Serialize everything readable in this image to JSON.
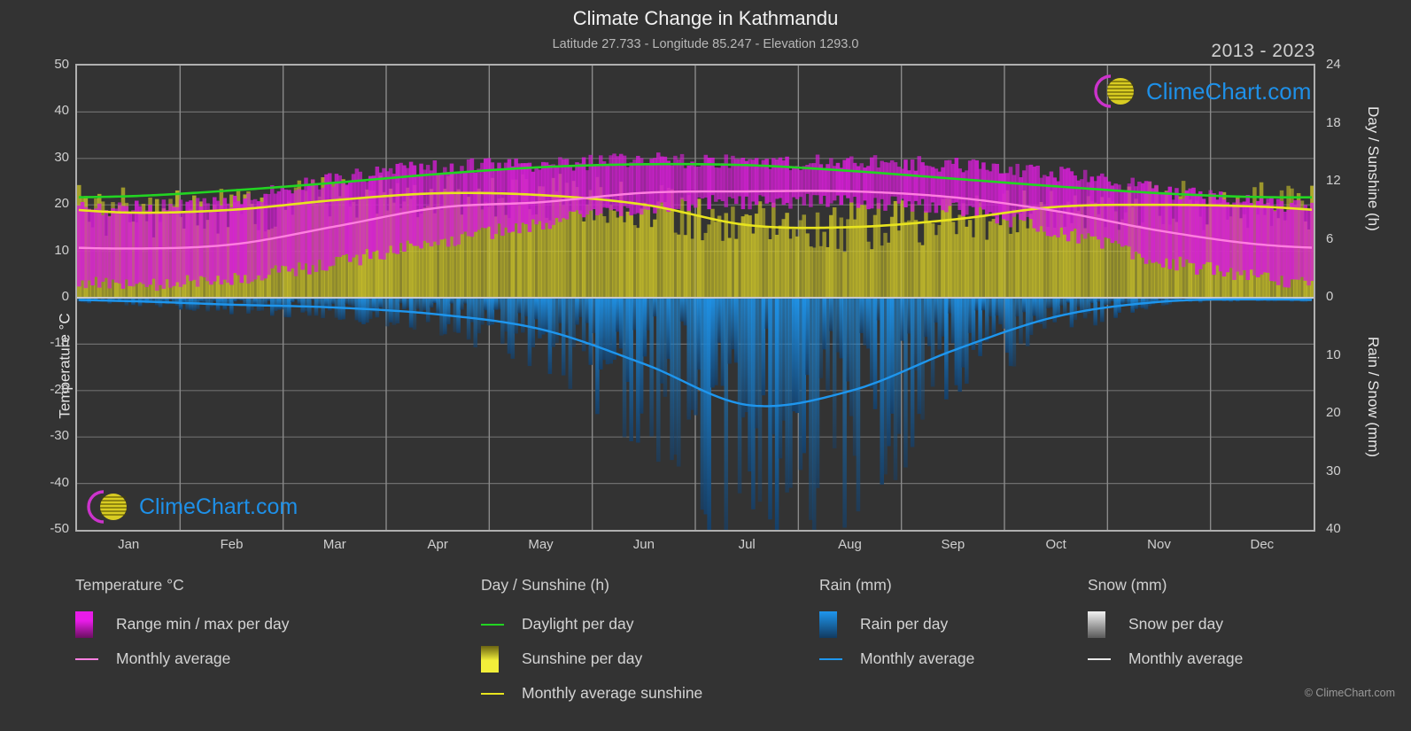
{
  "header": {
    "title": "Climate Change in Kathmandu",
    "subtitle": "Latitude 27.733 - Longitude 85.247 - Elevation 1293.0",
    "years": "2013 - 2023"
  },
  "branding": {
    "watermark_text": "ClimeChart.com",
    "copyright": "© ClimeChart.com",
    "logo_ring_color": "#cc33cc",
    "logo_globe_color": "#d8cc22",
    "logo_text_color": "#1e90e8"
  },
  "axes": {
    "left": {
      "label": "Temperature °C",
      "ticks": [
        "50",
        "40",
        "30",
        "20",
        "10",
        "0",
        "-10",
        "-20",
        "-30",
        "-40",
        "-50"
      ],
      "min": -50,
      "max": 50,
      "step": 10
    },
    "right_top": {
      "label": "Day / Sunshine (h)",
      "ticks": [
        "24",
        "18",
        "12",
        "6",
        "0"
      ],
      "min": 0,
      "max": 24,
      "step": 6
    },
    "right_bottom": {
      "label": "Rain / Snow (mm)",
      "ticks": [
        "0",
        "10",
        "20",
        "30",
        "40"
      ],
      "min": 0,
      "max": 40,
      "step": 10,
      "inverted": true
    },
    "x": {
      "ticks": [
        "Jan",
        "Feb",
        "Mar",
        "Apr",
        "May",
        "Jun",
        "Jul",
        "Aug",
        "Sep",
        "Oct",
        "Nov",
        "Dec"
      ]
    }
  },
  "legend": {
    "groups": [
      {
        "title": "Temperature °C",
        "items": [
          {
            "label": "Range min / max per day",
            "key": "swatch",
            "color": "#e81ce8",
            "color2": "#6a1060"
          },
          {
            "label": "Monthly average",
            "key": "line",
            "color": "#ff7fe0"
          }
        ]
      },
      {
        "title": "Day / Sunshine (h)",
        "items": [
          {
            "label": "Daylight per day",
            "key": "line",
            "color": "#22d422"
          },
          {
            "label": "Sunshine per day",
            "key": "swatch",
            "color": "#f2ef3a",
            "color2": "#6b6412"
          },
          {
            "label": "Monthly average sunshine",
            "key": "line",
            "color": "#e8e41e"
          }
        ]
      },
      {
        "title": "Rain (mm)",
        "items": [
          {
            "label": "Rain per day",
            "key": "swatch",
            "color": "#1e96ee",
            "color2": "#123a60"
          },
          {
            "label": "Monthly average",
            "key": "line",
            "color": "#1e96ee"
          }
        ]
      },
      {
        "title": "Snow (mm)",
        "items": [
          {
            "label": "Snow per day",
            "key": "swatch",
            "color": "#f2f2f2",
            "color2": "#5a5a5a"
          },
          {
            "label": "Monthly average",
            "key": "line",
            "color": "#e8e8e8"
          }
        ]
      }
    ]
  },
  "chart_data": {
    "type": "area",
    "title": "Climate Change in Kathmandu",
    "subtitle": "Latitude 27.733 - Longitude 85.247 - Elevation 1293.0",
    "period": "2013 - 2023",
    "xlabel": "",
    "ylabel": "Temperature °C",
    "ylim": [
      -50,
      50
    ],
    "y2_top_label": "Day / Sunshine (h)",
    "y2_top_lim": [
      0,
      24
    ],
    "y2_bottom_label": "Rain / Snow (mm)",
    "y2_bottom_lim": [
      0,
      40
    ],
    "grid": true,
    "legend_position": "below",
    "categories": [
      "Jan",
      "Feb",
      "Mar",
      "Apr",
      "May",
      "Jun",
      "Jul",
      "Aug",
      "Sep",
      "Oct",
      "Nov",
      "Dec"
    ],
    "series": [
      {
        "name": "Monthly average temperature (°C)",
        "color": "#ff7fe0",
        "unit": "°C",
        "values": [
          10.6,
          11.5,
          15.4,
          19.4,
          20.6,
          22.6,
          22.9,
          22.9,
          21.6,
          18.6,
          14.4,
          11.4
        ]
      },
      {
        "name": "Daily max temperature (°C)",
        "color": "#e81ce8",
        "unit": "°C",
        "values": [
          19.0,
          21.0,
          25.5,
          28.0,
          28.5,
          29.5,
          29.0,
          29.0,
          28.5,
          26.5,
          23.0,
          20.0
        ]
      },
      {
        "name": "Daily min temperature (°C)",
        "color": "#6a1060",
        "unit": "°C",
        "values": [
          2.5,
          4.0,
          7.5,
          12.0,
          16.0,
          19.5,
          20.5,
          20.5,
          19.0,
          14.0,
          8.0,
          4.0
        ]
      },
      {
        "name": "Daylight per day (h)",
        "color": "#22d422",
        "unit": "h",
        "values": [
          10.5,
          11.1,
          11.9,
          12.8,
          13.5,
          13.8,
          13.7,
          13.1,
          12.3,
          11.5,
          10.8,
          10.4
        ]
      },
      {
        "name": "Monthly average sunshine (h)",
        "color": "#e8e41e",
        "unit": "h",
        "values": [
          8.8,
          9.1,
          10.1,
          10.8,
          10.6,
          9.6,
          7.5,
          7.3,
          8.1,
          9.4,
          9.6,
          9.4
        ]
      },
      {
        "name": "Monthly average rain (mm)",
        "color": "#1e96ee",
        "unit": "mm",
        "values": [
          0.6,
          1.2,
          1.7,
          2.9,
          5.5,
          11.5,
          18.5,
          16.0,
          9.0,
          3.2,
          0.7,
          0.3
        ]
      },
      {
        "name": "Monthly average snow (mm)",
        "color": "#e8e8e8",
        "unit": "mm",
        "values": [
          0,
          0,
          0,
          0,
          0,
          0,
          0,
          0,
          0,
          0,
          0,
          0
        ]
      }
    ]
  }
}
